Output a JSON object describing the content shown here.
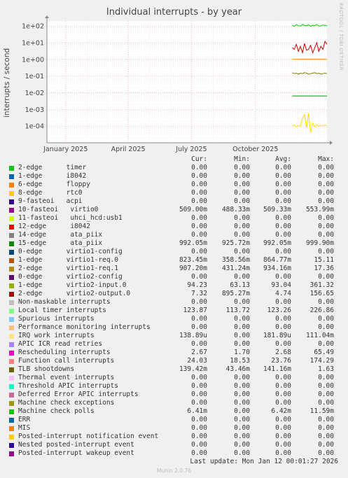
{
  "title": "Individual interrupts - by year",
  "side_text": "RRDTOOL / TOBI OETIKER",
  "ylabel": "interrupts / second",
  "columns": {
    "cur": "Cur:",
    "min": "Min:",
    "avg": "Avg:",
    "max": "Max:"
  },
  "last_update": "Last update: Mon Jan 12 00:01:27 2026",
  "version": "Munin 2.0.76",
  "chart_data": {
    "type": "line",
    "title": "Individual interrupts - by year",
    "ylabel": "interrupts / second",
    "yscale": "log",
    "ylim": [
      1e-05,
      200
    ],
    "y_ticks": [
      {
        "v": 100,
        "label": "1e+02"
      },
      {
        "v": 10,
        "label": "1e+01"
      },
      {
        "v": 1,
        "label": "1e+00"
      },
      {
        "v": 0.1,
        "label": "1e-01"
      },
      {
        "v": 0.01,
        "label": "1e-02"
      },
      {
        "v": 0.001,
        "label": "1e-03"
      },
      {
        "v": 0.0001,
        "label": "1e-04"
      }
    ],
    "xlim": [
      "2024-12-05",
      "2026-01-12"
    ],
    "x_ticks": [
      {
        "x": "2025-01-01",
        "label": "January 2025"
      },
      {
        "x": "2025-04-01",
        "label": "April 2025"
      },
      {
        "x": "2025-07-01",
        "label": "July 2025"
      },
      {
        "x": "2025-10-01",
        "label": "October 2025"
      }
    ],
    "data_start": "2025-11-23",
    "grid": true,
    "series": [
      {
        "color": "#00cc00",
        "values": [
          110,
          98,
          120,
          105,
          100,
          125,
          108,
          102,
          118,
          97,
          112,
          106,
          122,
          101,
          99,
          116,
          109,
          103
        ]
      },
      {
        "color": "#cc0000",
        "values": [
          5,
          4,
          8,
          3,
          6,
          2.5,
          9,
          3.5,
          4,
          7,
          2.5,
          5,
          10,
          3,
          6,
          4,
          12,
          8
        ]
      },
      {
        "color": "#ff8000",
        "values": [
          1,
          1,
          1,
          1,
          1,
          1,
          1,
          1,
          1,
          1,
          1,
          1,
          1,
          1,
          1,
          1,
          1,
          1
        ]
      },
      {
        "color": "#7d7d00",
        "values": [
          0.16,
          0.14,
          0.15,
          0.13,
          0.15,
          0.14,
          0.16,
          0.15,
          0.13,
          0.14,
          0.15,
          0.16,
          0.14,
          0.15,
          0.13,
          0.14,
          0.15,
          0.14
        ]
      },
      {
        "color": "#00a000",
        "values": [
          0.0064,
          0.0064,
          0.0064,
          0.0064,
          0.0064,
          0.0064,
          0.0064,
          0.0064,
          0.0064,
          0.0064,
          0.0064,
          0.0064,
          0.0064,
          0.0064,
          0.0064,
          0.0064,
          0.0064,
          0.0064
        ]
      },
      {
        "color": "#ffdd00",
        "values": [
          0.0001,
          0.00012,
          9e-05,
          0.00011,
          0.0001,
          0.0003,
          0.0005,
          8e-05,
          0.0006,
          4e-05,
          0.00015,
          9e-05,
          0.00012,
          0.0001,
          0.00011,
          0.0001,
          0.00012,
          0.0001
        ]
      }
    ]
  },
  "legend": [
    {
      "label": "2-edge      timer",
      "color": "#00cc00",
      "cur": "0.00",
      "min": "0.00",
      "avg": "0.00",
      "max": "0.00"
    },
    {
      "label": "1-edge      i8042",
      "color": "#0066b3",
      "cur": "0.00",
      "min": "0.00",
      "avg": "0.00",
      "max": "0.00"
    },
    {
      "label": "6-edge      floppy",
      "color": "#ff8000",
      "cur": "0.00",
      "min": "0.00",
      "avg": "0.00",
      "max": "0.00"
    },
    {
      "label": "8-edge      rtc0",
      "color": "#ffcc00",
      "cur": "0.00",
      "min": "0.00",
      "avg": "0.00",
      "max": "0.00"
    },
    {
      "label": "9-fasteoi   acpi",
      "color": "#330099",
      "cur": "0.00",
      "min": "0.00",
      "avg": "0.00",
      "max": "0.00"
    },
    {
      "label": "10-fasteoi   virtio0",
      "color": "#990099",
      "cur": "509.00m",
      "min": "488.33m",
      "avg": "509.33m",
      "max": "553.99m"
    },
    {
      "label": "11-fasteoi   uhci_hcd:usb1",
      "color": "#ccff00",
      "cur": "0.00",
      "min": "0.00",
      "avg": "0.00",
      "max": "0.00"
    },
    {
      "label": "12-edge      i8042",
      "color": "#ff0000",
      "cur": "0.00",
      "min": "0.00",
      "avg": "0.00",
      "max": "0.00"
    },
    {
      "label": "14-edge      ata_piix",
      "color": "#808080",
      "cur": "0.00",
      "min": "0.00",
      "avg": "0.00",
      "max": "0.00"
    },
    {
      "label": "15-edge      ata_piix",
      "color": "#008f00",
      "cur": "992.05m",
      "min": "925.72m",
      "avg": "992.05m",
      "max": "999.90m"
    },
    {
      "label": "0-edge      virtio1-config",
      "color": "#00487d",
      "cur": "0.00",
      "min": "0.00",
      "avg": "0.00",
      "max": "0.00"
    },
    {
      "label": "1-edge      virtio1-req.0",
      "color": "#b35a00",
      "cur": "823.45m",
      "min": "358.56m",
      "avg": "864.77m",
      "max": "15.11"
    },
    {
      "label": "2-edge      virtio1-req.1",
      "color": "#b38f00",
      "cur": "907.20m",
      "min": "431.24m",
      "avg": "934.16m",
      "max": "17.36"
    },
    {
      "label": "0-edge      virtio2-config",
      "color": "#6b006b",
      "cur": "0.00",
      "min": "0.00",
      "avg": "0.00",
      "max": "0.00"
    },
    {
      "label": "1-edge      virtio2-input.0",
      "color": "#8fb300",
      "cur": "94.23",
      "min": "63.13",
      "avg": "93.04",
      "max": "361.32"
    },
    {
      "label": "2-edge      virtio2-output.0",
      "color": "#b30000",
      "cur": "7.32",
      "min": "895.27m",
      "avg": "4.74",
      "max": "156.65"
    },
    {
      "label": "Non-maskable interrupts",
      "color": "#bebebe",
      "cur": "0.00",
      "min": "0.00",
      "avg": "0.00",
      "max": "0.00"
    },
    {
      "label": "Local timer interrupts",
      "color": "#80ff80",
      "cur": "123.87",
      "min": "113.72",
      "avg": "123.26",
      "max": "226.86"
    },
    {
      "label": "Spurious interrupts",
      "color": "#80c9ff",
      "cur": "0.00",
      "min": "0.00",
      "avg": "0.00",
      "max": "0.00"
    },
    {
      "label": "Performance monitoring interrupts",
      "color": "#ffc080",
      "cur": "0.00",
      "min": "0.00",
      "avg": "0.00",
      "max": "0.00"
    },
    {
      "label": "IRQ work interrupts",
      "color": "#ffe680",
      "cur": "138.89u",
      "min": "0.00",
      "avg": "181.89u",
      "max": "111.04m"
    },
    {
      "label": "APIC ICR read retries",
      "color": "#aa80ff",
      "cur": "0.00",
      "min": "0.00",
      "avg": "0.00",
      "max": "0.00"
    },
    {
      "label": "Rescheduling interrupts",
      "color": "#ee00cc",
      "cur": "2.67",
      "min": "1.70",
      "avg": "2.68",
      "max": "65.49"
    },
    {
      "label": "Function call interrupts",
      "color": "#ff8080",
      "cur": "24.03",
      "min": "18.53",
      "avg": "23.76",
      "max": "174.29"
    },
    {
      "label": "TLB shootdowns",
      "color": "#666600",
      "cur": "139.42m",
      "min": "43.46m",
      "avg": "141.16m",
      "max": "1.63"
    },
    {
      "label": "Thermal event interrupts",
      "color": "#ffbfff",
      "cur": "0.00",
      "min": "0.00",
      "avg": "0.00",
      "max": "0.00"
    },
    {
      "label": "Threshold APIC interrupts",
      "color": "#00ffcc",
      "cur": "0.00",
      "min": "0.00",
      "avg": "0.00",
      "max": "0.00"
    },
    {
      "label": "Deferred Error APIC interrupts",
      "color": "#cc6699",
      "cur": "0.00",
      "min": "0.00",
      "avg": "0.00",
      "max": "0.00"
    },
    {
      "label": "Machine check exceptions",
      "color": "#999900",
      "cur": "0.00",
      "min": "0.00",
      "avg": "0.00",
      "max": "0.00"
    },
    {
      "label": "Machine check polls",
      "color": "#00cc00",
      "cur": "6.41m",
      "min": "0.00",
      "avg": "6.42m",
      "max": "11.59m"
    },
    {
      "label": "ERR",
      "color": "#0066b3",
      "cur": "0.00",
      "min": "0.00",
      "avg": "0.00",
      "max": "0.00"
    },
    {
      "label": "MIS",
      "color": "#ff8000",
      "cur": "0.00",
      "min": "0.00",
      "avg": "0.00",
      "max": "0.00"
    },
    {
      "label": "Posted-interrupt notification event",
      "color": "#ffcc00",
      "cur": "0.00",
      "min": "0.00",
      "avg": "0.00",
      "max": "0.00"
    },
    {
      "label": "Nested posted-interrupt event",
      "color": "#330099",
      "cur": "0.00",
      "min": "0.00",
      "avg": "0.00",
      "max": "0.00"
    },
    {
      "label": "Posted-interrupt wakeup event",
      "color": "#990099",
      "cur": "0.00",
      "min": "0.00",
      "avg": "0.00",
      "max": "0.00"
    }
  ]
}
